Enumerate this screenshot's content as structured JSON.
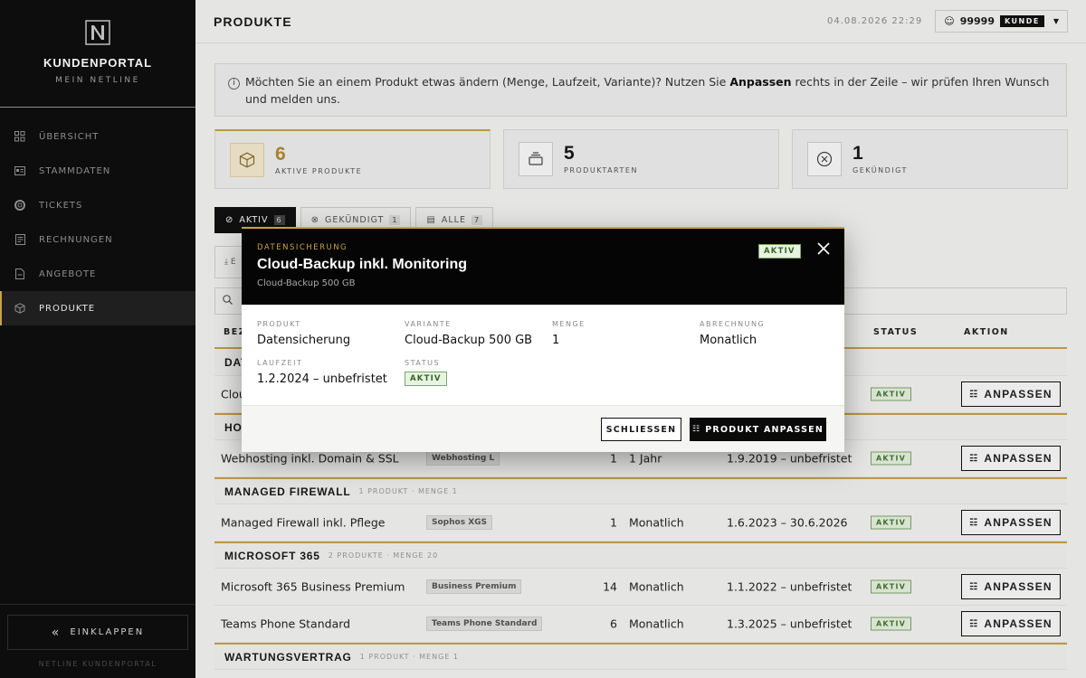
{
  "sidebar": {
    "title": "KUNDENPORTAL",
    "subtitle": "MEIN NETLINE",
    "items": [
      {
        "label": "ÜBERSICHT",
        "icon": "grid-icon"
      },
      {
        "label": "STAMMDATEN",
        "icon": "id-card-icon"
      },
      {
        "label": "TICKETS",
        "icon": "lifebuoy-icon"
      },
      {
        "label": "RECHNUNGEN",
        "icon": "invoice-icon"
      },
      {
        "label": "ANGEBOTE",
        "icon": "document-icon"
      },
      {
        "label": "PRODUKTE",
        "icon": "cube-icon",
        "active": true
      }
    ],
    "collapse_label": "EINKLAPPEN",
    "footer": "NETLINE KUNDENPORTAL"
  },
  "header": {
    "title": "PRODUKTE",
    "datetime": "04.08.2026 22:29",
    "user_id": "99999",
    "role": "KUNDE"
  },
  "info": {
    "text_before": "Möchten Sie an einem Produkt etwas ändern (Menge, Laufzeit, Variante)? Nutzen Sie ",
    "text_bold": "Anpassen",
    "text_after": " rechts in der Zeile – wir prüfen Ihren Wunsch und melden uns."
  },
  "stats": [
    {
      "value": "6",
      "label": "AKTIVE PRODUKTE"
    },
    {
      "value": "5",
      "label": "PRODUKTARTEN"
    },
    {
      "value": "1",
      "label": "GEKÜNDIGT"
    }
  ],
  "tabs": [
    {
      "label": "AKTIV",
      "count": "6"
    },
    {
      "label": "GEKÜNDIGT",
      "count": "1"
    },
    {
      "label": "ALLE",
      "count": "7"
    }
  ],
  "export_label": "E",
  "table": {
    "headers": {
      "name": "BEZ",
      "status": "STATUS",
      "action": "AKTION"
    },
    "adjust_label": "ANPASSEN",
    "groups": [
      {
        "name": "DAT",
        "meta": "",
        "rows": [
          {
            "name": "Clou",
            "variant": "",
            "qty": "",
            "term": "",
            "dates": "",
            "status": "AKTIV"
          }
        ]
      },
      {
        "name": "HO",
        "meta": "",
        "rows": [
          {
            "name": "Webhosting inkl. Domain & SSL",
            "variant": "Webhosting L",
            "qty": "1",
            "term": "1 Jahr",
            "dates": "1.9.2019 – unbefristet",
            "status": "AKTIV"
          }
        ]
      },
      {
        "name": "MANAGED FIREWALL",
        "meta": "1 PRODUKT · MENGE 1",
        "rows": [
          {
            "name": "Managed Firewall inkl. Pflege",
            "variant": "Sophos XGS",
            "qty": "1",
            "term": "Monatlich",
            "dates": "1.6.2023 – 30.6.2026",
            "status": "AKTIV"
          }
        ]
      },
      {
        "name": "MICROSOFT 365",
        "meta": "2 PRODUKTE · MENGE 20",
        "rows": [
          {
            "name": "Microsoft 365 Business Premium",
            "variant": "Business Premium",
            "qty": "14",
            "term": "Monatlich",
            "dates": "1.1.2022 – unbefristet",
            "status": "AKTIV"
          },
          {
            "name": "Teams Phone Standard",
            "variant": "Teams Phone Standard",
            "qty": "6",
            "term": "Monatlich",
            "dates": "1.3.2025 – unbefristet",
            "status": "AKTIV"
          }
        ]
      },
      {
        "name": "WARTUNGSVERTRAG",
        "meta": "1 PRODUKT · MENGE 1",
        "rows": []
      }
    ]
  },
  "modal": {
    "category": "DATENSICHERUNG",
    "title": "Cloud-Backup inkl. Monitoring",
    "subtitle": "Cloud-Backup 500 GB",
    "status": "AKTIV",
    "fields": {
      "produkt_label": "PRODUKT",
      "produkt_value": "Datensicherung",
      "variante_label": "VARIANTE",
      "variante_value": "Cloud-Backup 500 GB",
      "menge_label": "MENGE",
      "menge_value": "1",
      "abrechnung_label": "ABRECHNUNG",
      "abrechnung_value": "Monatlich",
      "laufzeit_label": "LAUFZEIT",
      "laufzeit_value": "1.2.2024 – unbefristet",
      "status_label": "STATUS",
      "status_value": "AKTIV"
    },
    "close_label": "SCHLIESSEN",
    "primary_label": "PRODUKT ANPASSEN"
  },
  "colors": {
    "accent": "#c8a24a",
    "sidebar_bg": "#0d0d0d",
    "status_green": "#3f7a2f"
  }
}
